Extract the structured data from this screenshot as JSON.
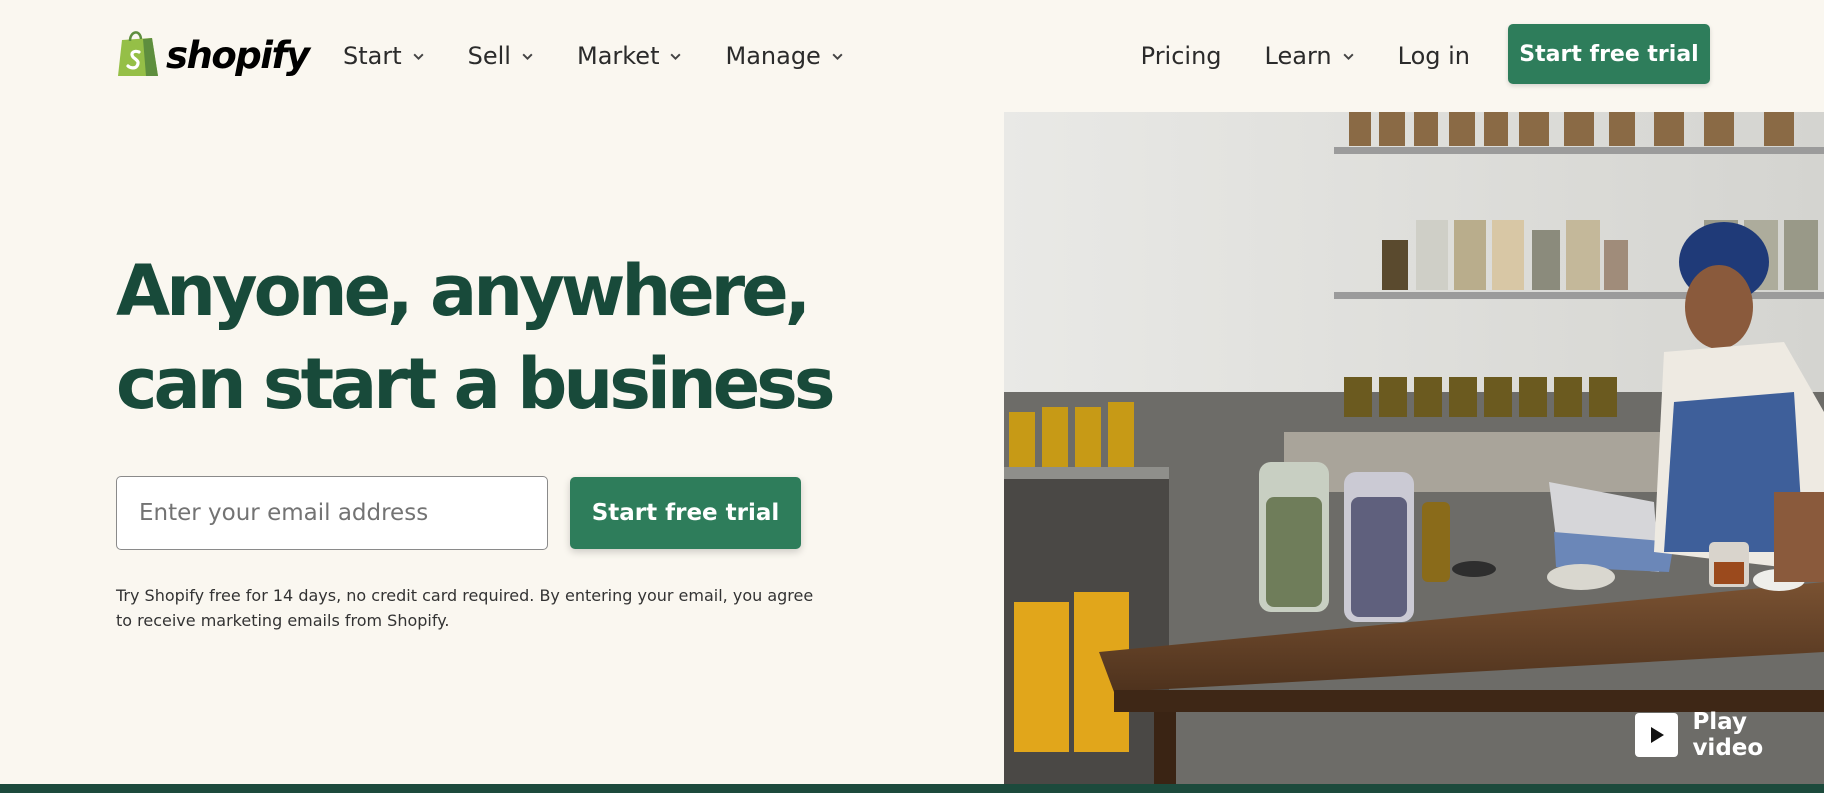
{
  "brand": {
    "name": "shopify",
    "logo_icon": "shopping-bag-icon",
    "colors": {
      "primary_button": "#2e7d5b",
      "heading": "#184a3a",
      "background": "#faf7f0",
      "logo_bag": "#95bf47"
    }
  },
  "nav": {
    "left": [
      {
        "label": "Start",
        "has_dropdown": true
      },
      {
        "label": "Sell",
        "has_dropdown": true
      },
      {
        "label": "Market",
        "has_dropdown": true
      },
      {
        "label": "Manage",
        "has_dropdown": true
      }
    ],
    "right": {
      "pricing": "Pricing",
      "learn": "Learn",
      "login": "Log in"
    },
    "cta": "Start free trial"
  },
  "hero": {
    "title_line1": "Anyone, anywhere,",
    "title_line2": "can start a business",
    "email_placeholder": "Enter your email address",
    "cta": "Start free trial",
    "disclaimer": "Try Shopify free for 14 days, no credit card required. By entering your email, you agree to receive marketing emails from Shopify."
  },
  "media": {
    "play_label": "Play video",
    "play_icon": "play-icon"
  }
}
